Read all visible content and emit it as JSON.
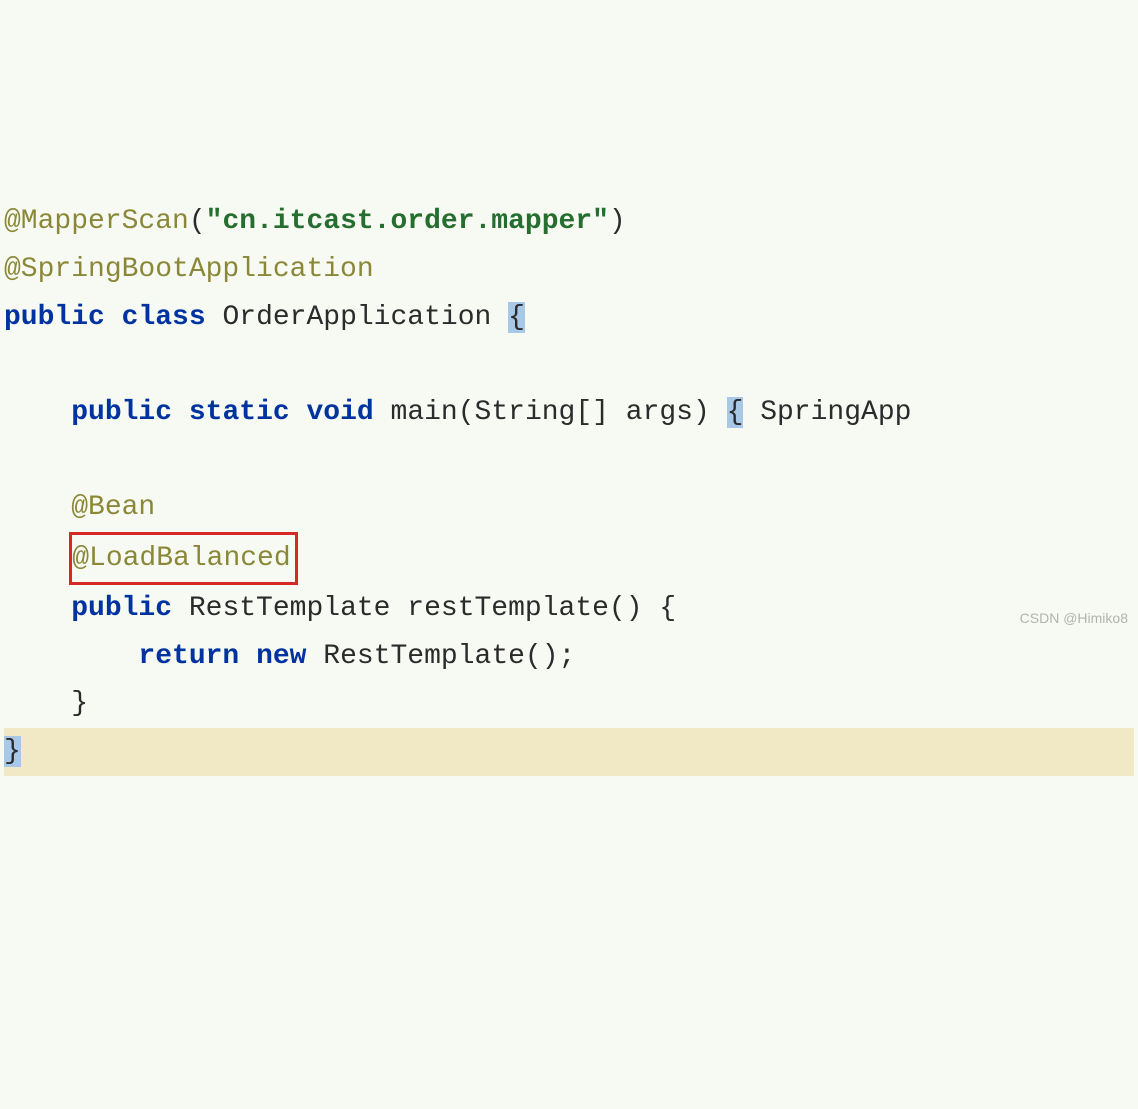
{
  "code": {
    "line1": {
      "annotation": "@MapperScan",
      "paren_open": "(",
      "string": "\"cn.itcast.order.mapper\"",
      "paren_close": ")"
    },
    "line2": {
      "annotation": "@SpringBootApplication"
    },
    "line3": {
      "kw_public": "public",
      "kw_class": "class",
      "classname": " OrderApplication ",
      "brace": "{"
    },
    "line5": {
      "indent": "    ",
      "kw_public": "public",
      "kw_static": "static",
      "kw_void": "void",
      "sig": " main(String[] args) ",
      "brace": "{",
      "tail": " SpringApp"
    },
    "line7": {
      "indent": "    ",
      "annotation": "@Bean"
    },
    "line8": {
      "indent": "    ",
      "annotation": "@LoadBalanced"
    },
    "line9": {
      "indent": "    ",
      "kw_public": "public",
      "sig": " RestTemplate restTemplate() {"
    },
    "line10": {
      "indent": "        ",
      "kw_return": "return",
      "kw_new": "new",
      "expr": " RestTemplate();"
    },
    "line11": {
      "indent": "    ",
      "brace": "}"
    },
    "line12": {
      "brace": "}"
    }
  },
  "watermark": "CSDN @Himiko8"
}
